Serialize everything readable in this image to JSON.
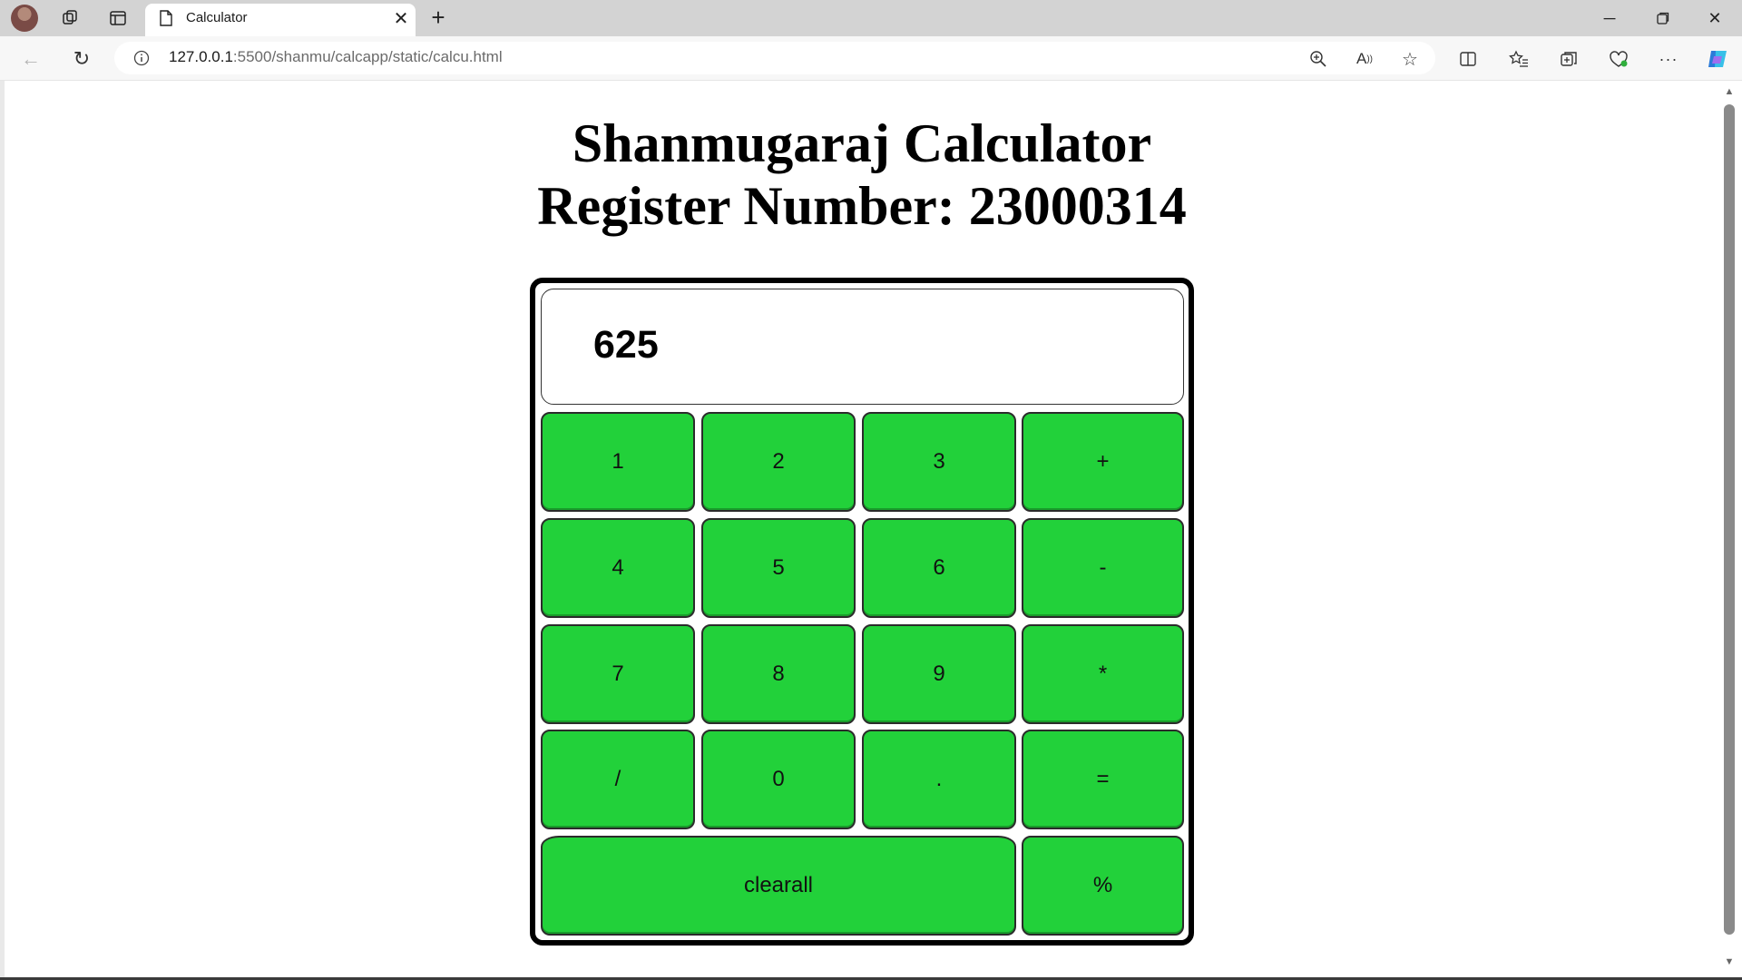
{
  "browser": {
    "tab_title": "Calculator",
    "url_host": "127.0.0.1",
    "url_rest": ":5500/shanmu/calcapp/static/calcu.html"
  },
  "page": {
    "heading_line1": "Shanmugaraj Calculator",
    "heading_line2": "Register Number: 23000314"
  },
  "calculator": {
    "display_value": "625",
    "keys": [
      "1",
      "2",
      "3",
      "+",
      "4",
      "5",
      "6",
      "-",
      "7",
      "8",
      "9",
      "*",
      "/",
      "0",
      ".",
      "=",
      "clearall",
      "%"
    ]
  },
  "colors": {
    "key_green": "#22d13a",
    "border": "#000000"
  }
}
